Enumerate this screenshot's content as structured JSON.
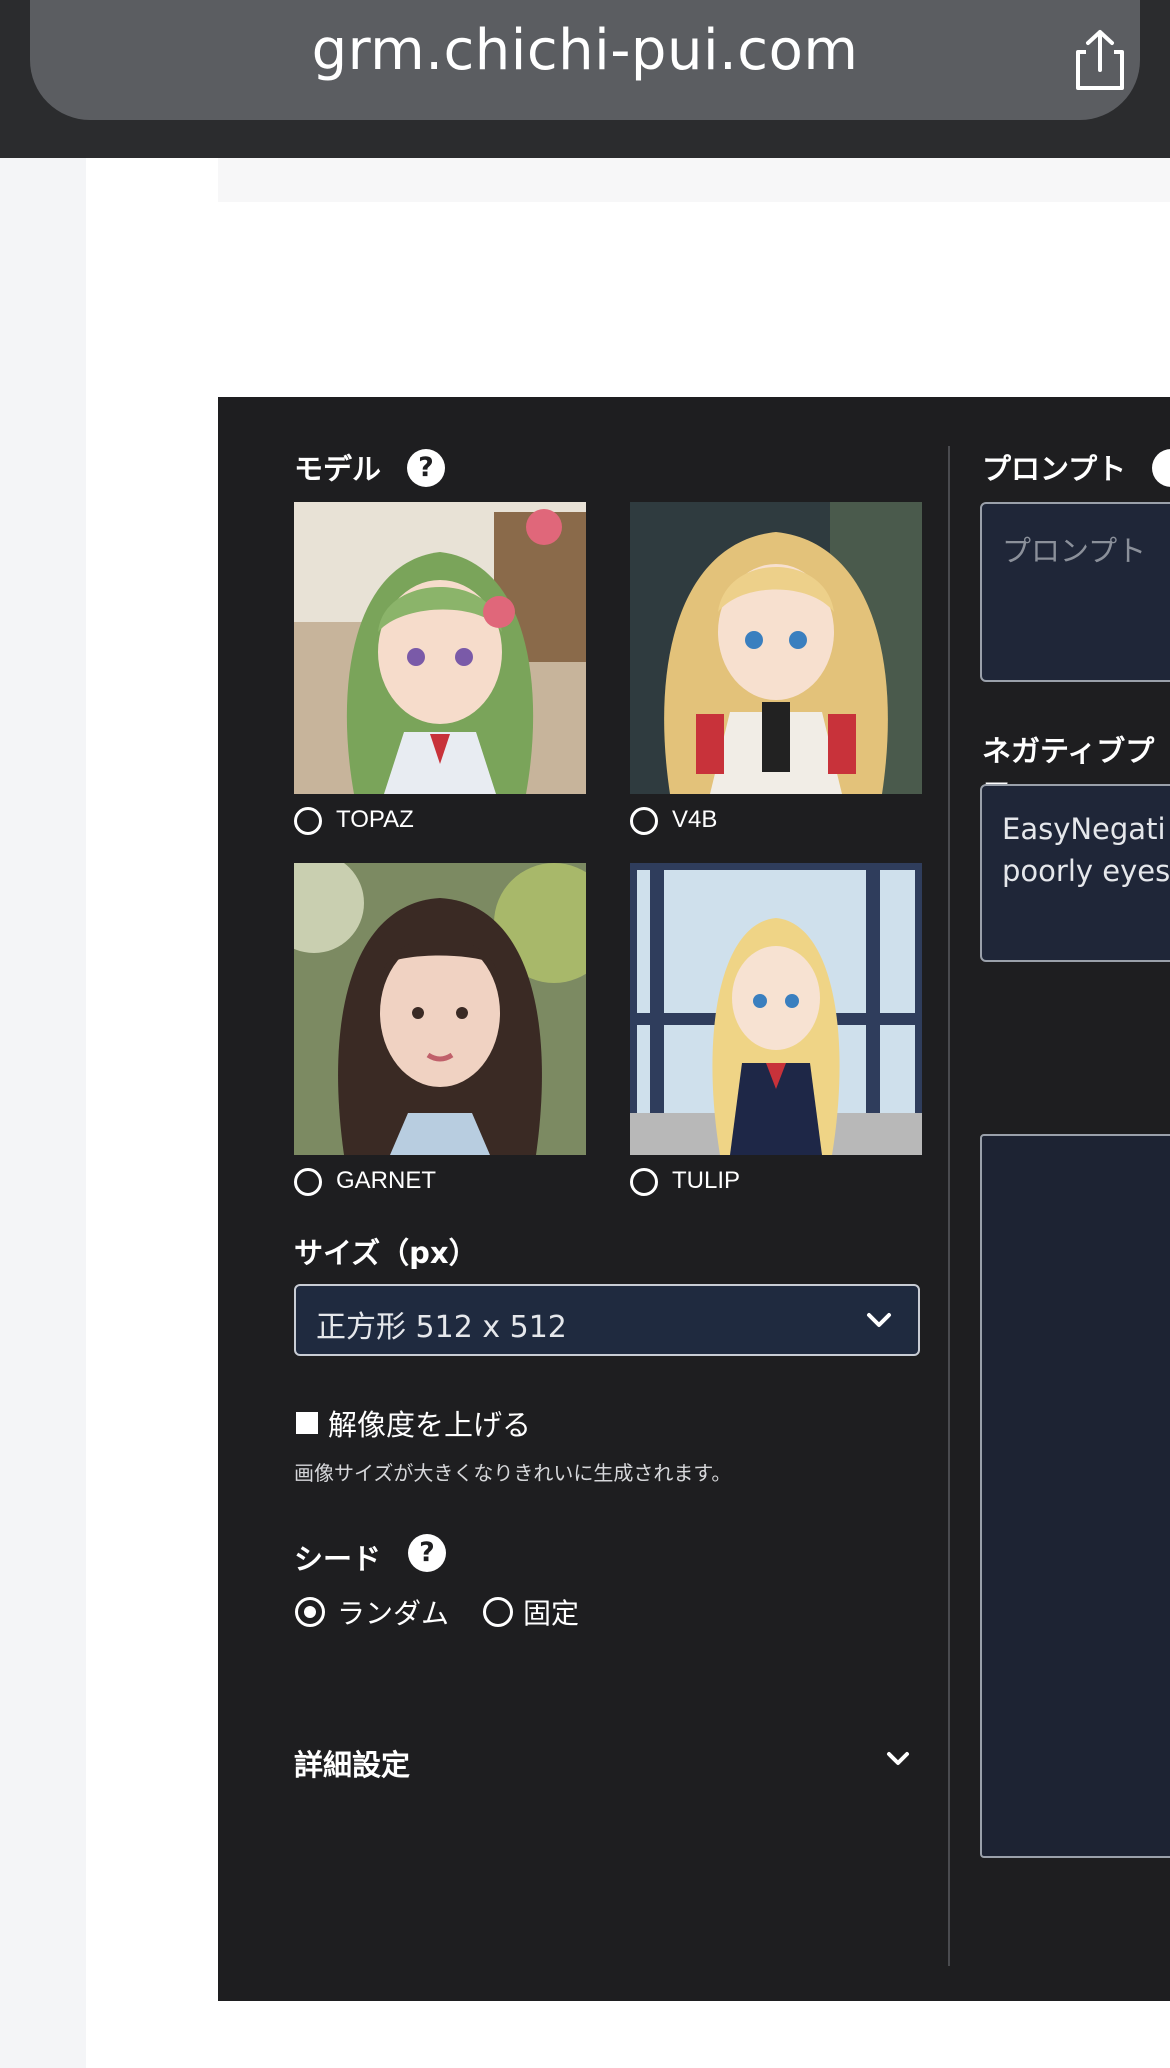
{
  "browser": {
    "url": "grm.chichi-pui.com"
  },
  "generator": {
    "model": {
      "label": "モデル",
      "help": "?",
      "options": [
        {
          "name": "TOPAZ"
        },
        {
          "name": "V4B"
        },
        {
          "name": "GARNET"
        },
        {
          "name": "TULIP"
        }
      ]
    },
    "size": {
      "label": "サイズ（px）",
      "selected": "正方形 512 x 512"
    },
    "hires": {
      "label": "解像度を上げる",
      "note": "画像サイズが大きくなりきれいに生成されます。"
    },
    "seed": {
      "label": "シード",
      "help": "?",
      "options": [
        "ランダム",
        "固定"
      ],
      "selected": "ランダム"
    },
    "advanced": {
      "label": "詳細設定"
    },
    "prompt": {
      "label": "プロンプト",
      "placeholder": "プロンプト"
    },
    "negative_prompt": {
      "label": "ネガティブプロ",
      "lines": [
        "EasyNegati",
        "poorly eyes"
      ]
    }
  }
}
